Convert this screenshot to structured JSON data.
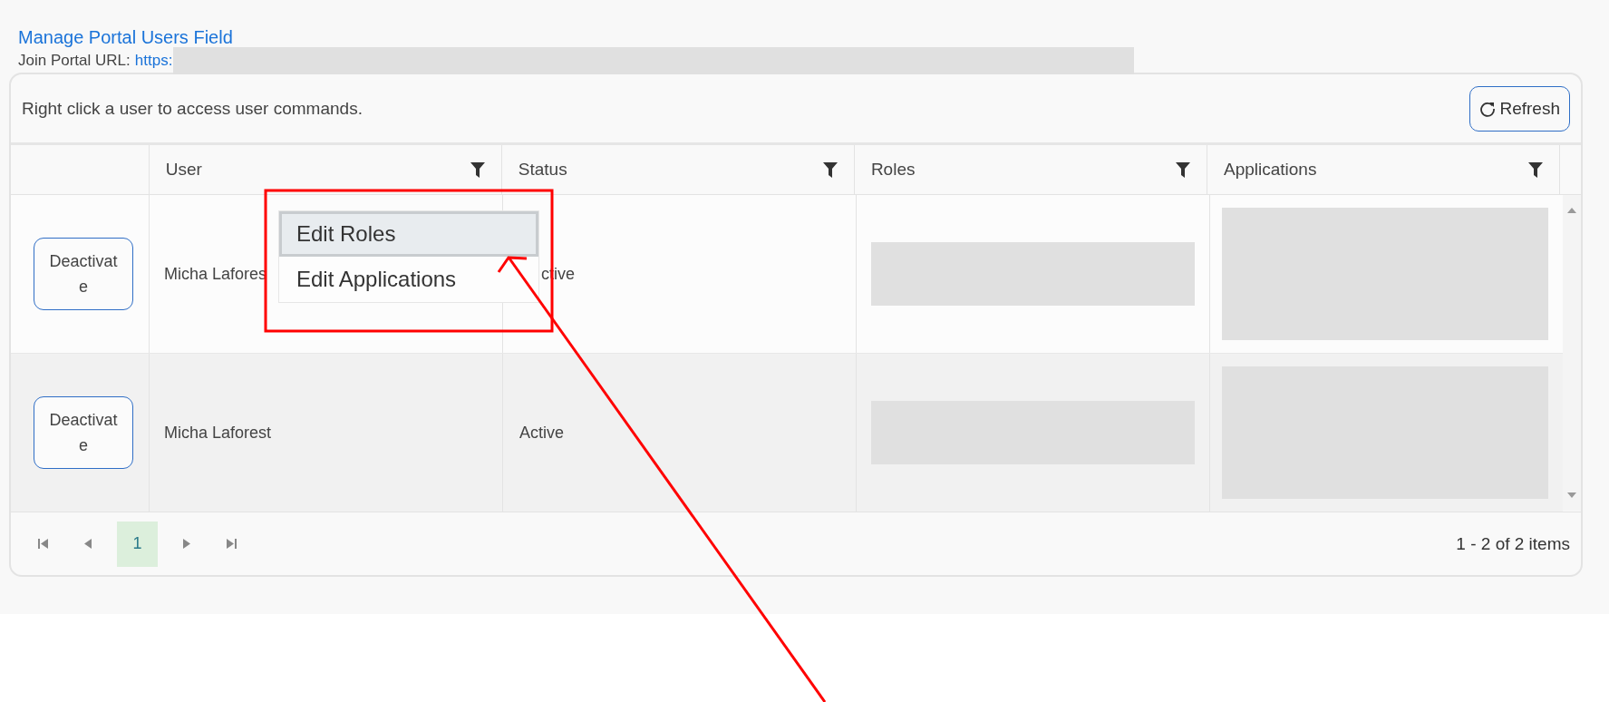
{
  "header": {
    "title": "Manage Portal Users Field",
    "url_label": "Join Portal URL:",
    "url_link": "https:"
  },
  "grid": {
    "hint": "Right click a user to access user commands.",
    "refresh_button": "Refresh",
    "columns": [
      "User",
      "Status",
      "Roles",
      "Applications"
    ],
    "rows": [
      {
        "action": "Deactivate",
        "user": "Micha Lafores",
        "status": "ctive"
      },
      {
        "action": "Deactivate",
        "user": "Micha Laforest",
        "status": "Active"
      }
    ],
    "pager": {
      "pages": [
        {
          "label": "1",
          "selected": true
        }
      ],
      "summary": "1 - 2 of 2 items"
    }
  },
  "context_menu": {
    "items": [
      {
        "label": "Edit Roles",
        "selected": true
      },
      {
        "label": "Edit Applications",
        "selected": false
      }
    ]
  }
}
